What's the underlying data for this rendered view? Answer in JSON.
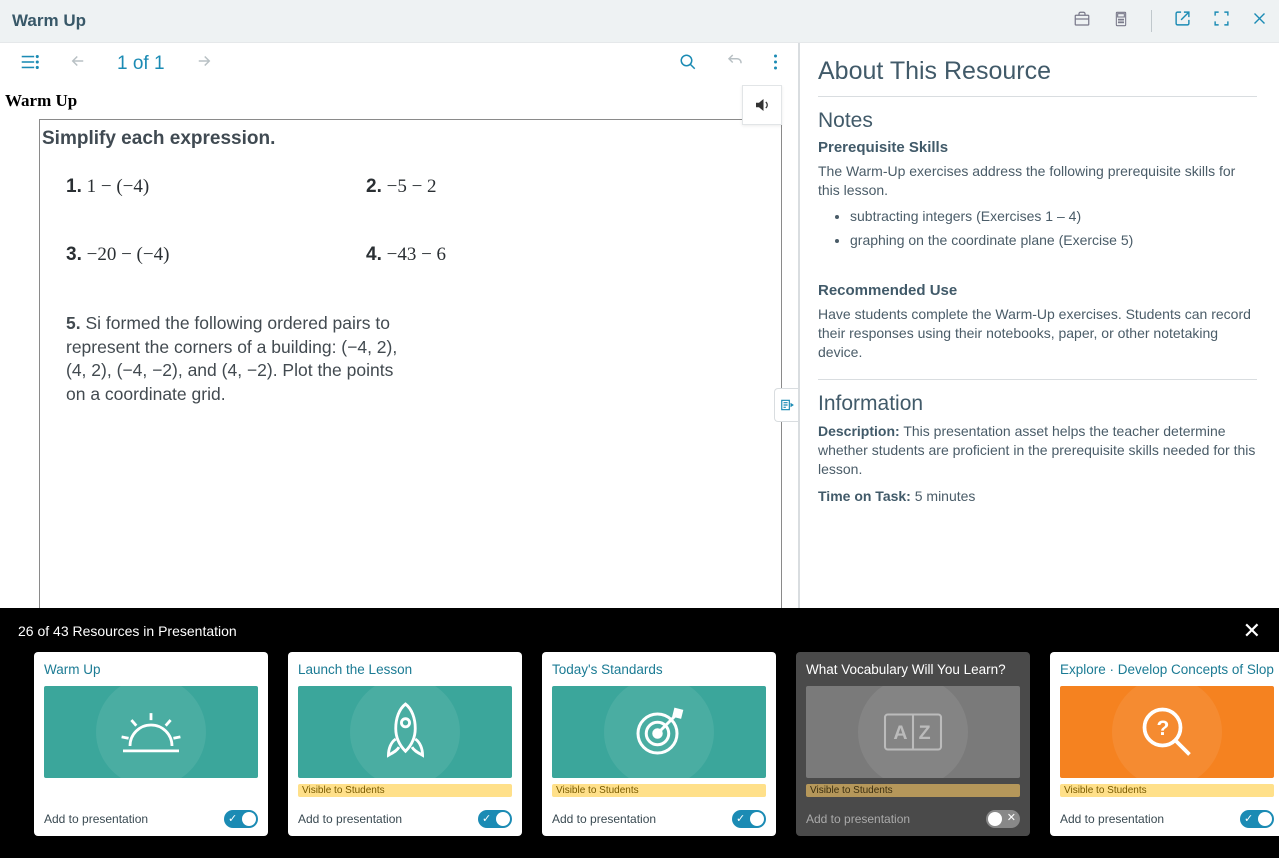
{
  "topbar": {
    "title": "Warm Up"
  },
  "toolbar": {
    "page_of": "1 of 1"
  },
  "content": {
    "heading": "Warm Up",
    "instruction": "Simplify each expression.",
    "p1_num": "1.",
    "p1": "1 − (−4)",
    "p2_num": "2.",
    "p2": "−5 − 2",
    "p3_num": "3.",
    "p3": "−20 − (−4)",
    "p4_num": "4.",
    "p4": "−43 − 6",
    "p5_num": "5.",
    "p5": "Si formed the following ordered pairs to represent the corners of a building: (−4, 2), (4, 2), (−4, −2), and (4, −2). Plot the points on a coordinate grid."
  },
  "sidebar": {
    "about": "About This Resource",
    "notes": "Notes",
    "prereq_h": "Prerequisite Skills",
    "prereq_p": "The Warm-Up exercises address the following prerequisite skills for this lesson.",
    "bullets": [
      "subtracting integers (Exercises 1 – 4)",
      "graphing on the coordinate plane (Exercise 5)"
    ],
    "recuse_h": "Recommended Use",
    "recuse_p": "Have students complete the Warm-Up exercises. Students can record their responses using their notebooks, paper, or other notetaking device.",
    "info": "Information",
    "desc_label": "Description:",
    "desc": "This presentation asset helps the teacher determine whether students are proficient in the prerequisite skills needed for this lesson.",
    "tot_label": "Time on Task:",
    "tot": "5 minutes"
  },
  "tray": {
    "count": "26 of 43 Resources in Presentation",
    "add_label": "Add to presentation",
    "visible_label": "Visible to Students",
    "cards": [
      {
        "title": "Warm Up",
        "visible": false,
        "on": true,
        "color": "teal",
        "icon": "sun"
      },
      {
        "title": "Launch the Lesson",
        "visible": true,
        "on": true,
        "color": "teal",
        "icon": "rocket"
      },
      {
        "title": "Today's Standards",
        "visible": true,
        "on": true,
        "color": "teal",
        "icon": "target"
      },
      {
        "title": "What Vocabulary Will You Learn?",
        "visible": true,
        "on": false,
        "color": "grey",
        "icon": "az",
        "dark": true
      },
      {
        "title": "Explore · Develop Concepts of Slope",
        "visible": true,
        "on": true,
        "color": "orange",
        "icon": "question"
      }
    ]
  }
}
